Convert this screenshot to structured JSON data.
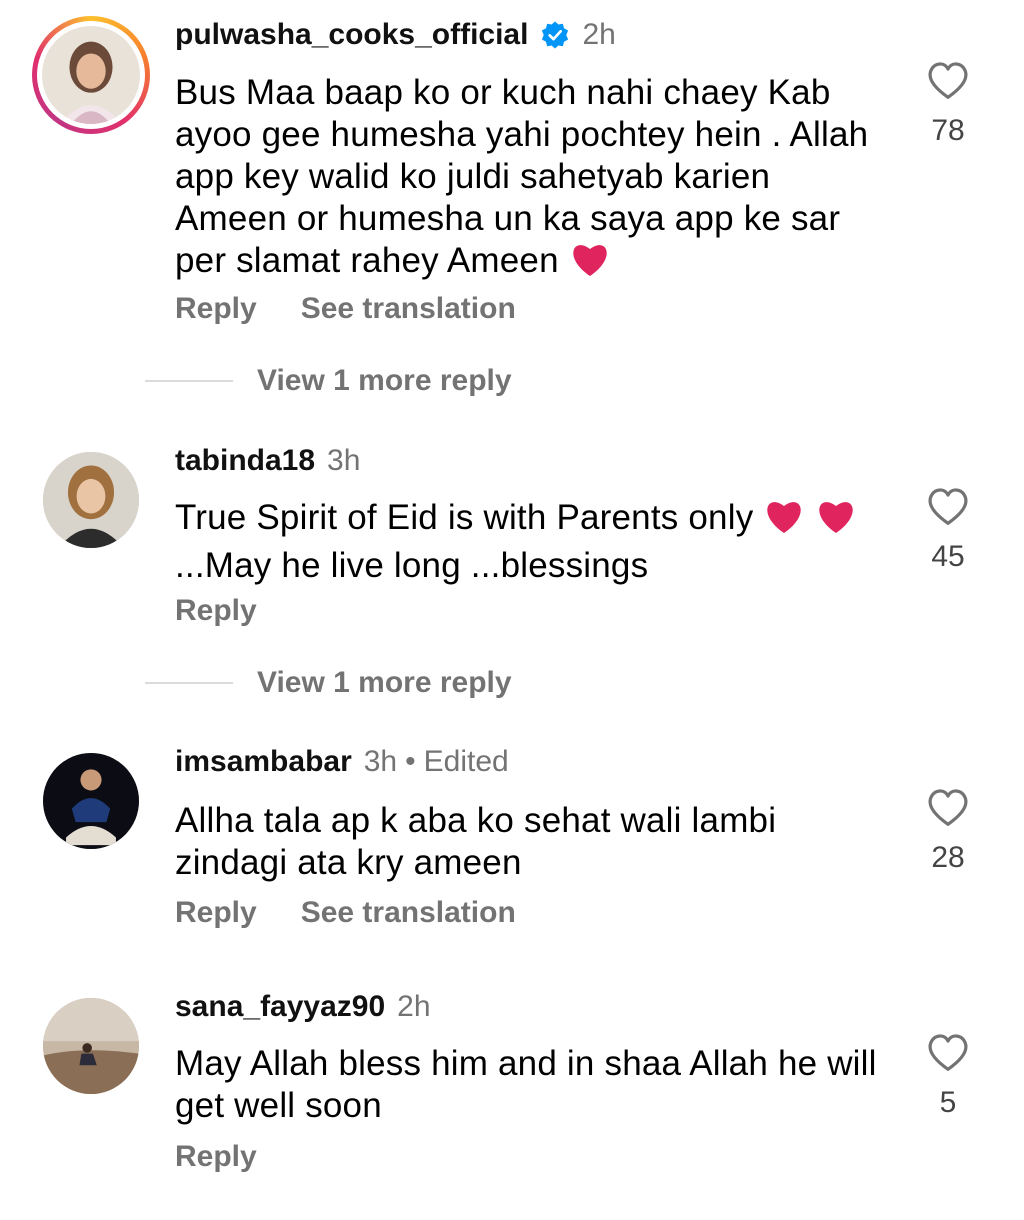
{
  "comments": [
    {
      "username": "pulwasha_cooks_official",
      "verified": true,
      "time": "2h",
      "text": "Bus Maa baap ko or kuch nahi chaey Kab ayoo gee humesha yahi pochtey hein . Allah app key walid ko juldi sahetyab karien Ameen or humesha un ka saya app ke sar per slamat rahey Ameen",
      "likes": "78",
      "reply_label": "Reply",
      "translation_label": "See translation",
      "view_more": "View 1 more reply"
    },
    {
      "username": "tabinda18",
      "time": "3h",
      "text_part1": "True Spirit of Eid is with Parents only",
      "text_part2": "...May he live long ...blessings",
      "likes": "45",
      "reply_label": "Reply",
      "view_more": "View 1 more reply"
    },
    {
      "username": "imsambabar",
      "time": "3h",
      "dot": "•",
      "edited": "Edited",
      "text": "Allha tala ap k aba ko sehat wali lambi zindagi ata kry ameen",
      "likes": "28",
      "reply_label": "Reply",
      "translation_label": "See translation"
    },
    {
      "username": "sana_fayyaz90",
      "time": "2h",
      "text": "May Allah bless him and in shaa Allah he will get well soon",
      "likes": "5",
      "reply_label": "Reply"
    }
  ],
  "icons": {
    "like": "heart-outline-icon",
    "verified": "verified-badge-icon",
    "emoji": "red-heart-emoji"
  },
  "colors": {
    "verified_blue": "#0095f6",
    "secondary_text": "#737373",
    "heart_red": "#e0245e"
  }
}
